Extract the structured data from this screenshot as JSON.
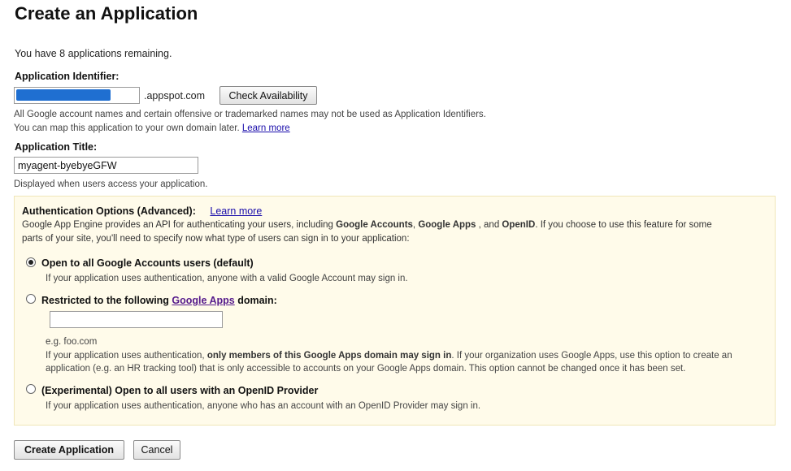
{
  "page": {
    "title": "Create an Application",
    "remaining": "You have 8 applications remaining."
  },
  "identifier": {
    "label": "Application Identifier:",
    "value": "",
    "suffix": ".appspot.com",
    "check_button": "Check Availability",
    "note_1": "All Google account names and certain offensive or trademarked names may not be used as Application Identifiers.",
    "note_2": "You can map this application to your own domain later.",
    "learn_more": "Learn more"
  },
  "app_title": {
    "label": "Application Title:",
    "value": "myagent-byebyeGFW",
    "note": "Displayed when users access your application."
  },
  "auth": {
    "heading": "Authentication Options (Advanced):",
    "learn_more": "Learn more",
    "desc_1_pre": "Google App Engine provides an API for authenticating your users, including ",
    "desc_1_b1": "Google Accounts",
    "desc_1_sep": ", ",
    "desc_1_b2": "Google Apps",
    "desc_1_mid": " , and ",
    "desc_1_b3": "OpenID",
    "desc_1_post": ". If you choose to use this feature for some",
    "desc_2": "parts of your site, you'll need to specify now what type of users can sign in to your application:",
    "options": [
      {
        "label": "Open to all Google Accounts users (default)",
        "note": "If your application uses authentication, anyone with a valid Google Account may sign in.",
        "checked": true
      },
      {
        "label_pre": "Restricted to the following ",
        "label_link": "Google Apps",
        "label_post": " domain:",
        "input_value": "",
        "example": "e.g. foo.com",
        "note_1_pre": "If your application uses authentication, ",
        "note_1_bold": "only members of this Google Apps domain may sign in",
        "note_1_post": ". If your organization uses Google Apps, use this option to create an",
        "note_2": "application (e.g. an HR tracking tool) that is only accessible to accounts on your Google Apps domain. This option cannot be changed once it has been set.",
        "checked": false
      },
      {
        "label": "(Experimental) Open to all users with an OpenID Provider",
        "note": "If your application uses authentication, anyone who has an account with an OpenID Provider may sign in.",
        "checked": false
      }
    ]
  },
  "actions": {
    "create": "Create Application",
    "cancel": "Cancel"
  }
}
